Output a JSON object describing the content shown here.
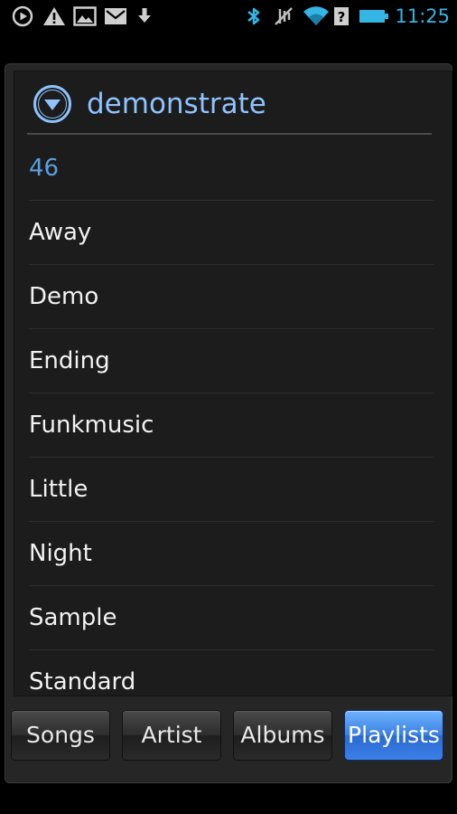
{
  "status_bar": {
    "time": "11:25",
    "icons": [
      "play-circle-icon",
      "warning-icon",
      "image-icon",
      "mail-icon",
      "download-icon",
      "bluetooth-icon",
      "vibrate-mute-icon",
      "wifi-icon",
      "signal-unknown-icon",
      "battery-icon"
    ],
    "accent_color": "#33b5e5"
  },
  "dialog": {
    "title": "demonstrate",
    "title_color": "#8ec3ff",
    "collapse_icon": "chevron-down-circle-icon"
  },
  "list": {
    "count": "46",
    "items": [
      "Away",
      "Demo",
      "Ending",
      "Funkmusic",
      "Little",
      "Night",
      "Sample",
      "Standard"
    ]
  },
  "tabs": [
    {
      "label": "Songs",
      "active": false
    },
    {
      "label": "Artist",
      "active": false
    },
    {
      "label": "Albums",
      "active": false
    },
    {
      "label": "Playlists",
      "active": true
    }
  ]
}
